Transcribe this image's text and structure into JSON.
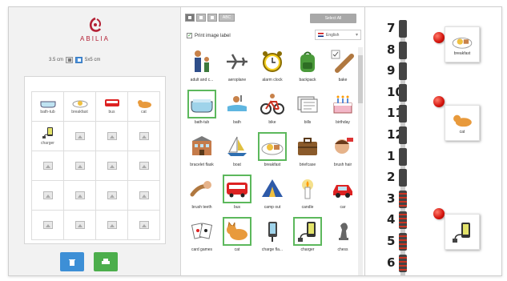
{
  "left_panel": {
    "logo_text": "ABILIA",
    "size_left": "3.5 cm",
    "size_right": "5x5 cm",
    "grid_labels": [
      "bath-tub",
      "breakfast",
      "bus",
      "cat"
    ],
    "charger_label": "charger"
  },
  "middle_panel": {
    "toolbar_abc": "ABC",
    "select_all": "Select All",
    "print_label": "Print image label",
    "language": "English",
    "pictograms": [
      {
        "label": "adult and c...",
        "icon": "adult-child-icon",
        "selected": false
      },
      {
        "label": "aeroplane",
        "icon": "aeroplane-icon",
        "selected": false
      },
      {
        "label": "alarm clock",
        "icon": "alarm-clock-icon",
        "selected": false
      },
      {
        "label": "backpack",
        "icon": "backpack-icon",
        "selected": false
      },
      {
        "label": "bake",
        "icon": "rolling-pin-icon",
        "selected": false
      },
      {
        "label": "bath-tub",
        "icon": "bathtub-icon",
        "selected": true
      },
      {
        "label": "bath",
        "icon": "bath-icon",
        "selected": false
      },
      {
        "label": "bike",
        "icon": "bike-icon",
        "selected": false
      },
      {
        "label": "bills",
        "icon": "bills-icon",
        "selected": false
      },
      {
        "label": "birthday",
        "icon": "cake-icon",
        "selected": false
      },
      {
        "label": "bracelet flask",
        "icon": "building-icon",
        "selected": false
      },
      {
        "label": "boat",
        "icon": "boat-icon",
        "selected": false
      },
      {
        "label": "breakfast",
        "icon": "breakfast-icon",
        "selected": true
      },
      {
        "label": "briefcase",
        "icon": "briefcase-icon",
        "selected": false
      },
      {
        "label": "brush hair",
        "icon": "brush-hair-icon",
        "selected": false
      },
      {
        "label": "brush teeth",
        "icon": "brush-teeth-icon",
        "selected": false
      },
      {
        "label": "bus",
        "icon": "bus-icon",
        "selected": true
      },
      {
        "label": "camp out",
        "icon": "tent-icon",
        "selected": false
      },
      {
        "label": "candle",
        "icon": "candle-icon",
        "selected": false
      },
      {
        "label": "car",
        "icon": "car-icon",
        "selected": false
      },
      {
        "label": "card games",
        "icon": "cards-icon",
        "selected": false
      },
      {
        "label": "cat",
        "icon": "cat-icon",
        "selected": true
      },
      {
        "label": "charge fla...",
        "icon": "charge-phone-icon",
        "selected": false
      },
      {
        "label": "charger",
        "icon": "charger-icon",
        "selected": true
      },
      {
        "label": "chess",
        "icon": "chess-icon",
        "selected": false
      }
    ]
  },
  "right_panel": {
    "hours": [
      "7",
      "8",
      "9",
      "10",
      "11",
      "12",
      "1",
      "2",
      "3",
      "4",
      "5",
      "6"
    ],
    "cards": [
      "breakfast",
      "cat",
      ""
    ]
  },
  "colors": {
    "brand": "#b32034",
    "select_green": "#5cb85c",
    "delete_blue": "#3d8fd6",
    "print_green": "#4cae4c",
    "red_marker": "#d3120b"
  }
}
